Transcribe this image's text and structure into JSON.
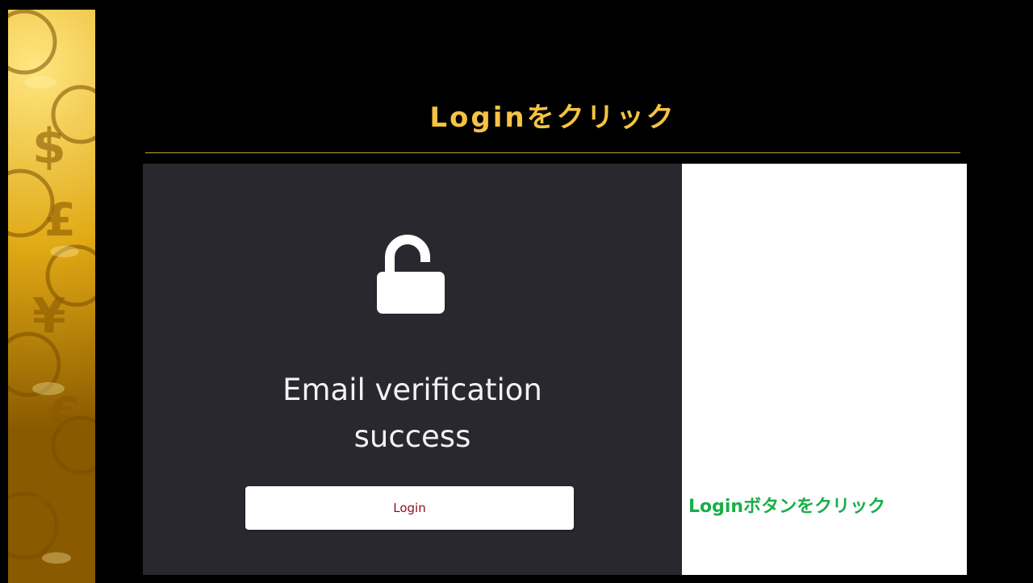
{
  "slide": {
    "title": "Loginをクリック"
  },
  "screen": {
    "message_line1": "Email verification",
    "message_line2": "success",
    "login_button_label": "Login",
    "icon": "unlock-icon"
  },
  "note": {
    "text": "Loginボタンをクリック"
  },
  "colors": {
    "title": "#f6c342",
    "screen_bg": "#29282f",
    "button_text": "#8a1020",
    "note_text": "#1aae4a"
  }
}
